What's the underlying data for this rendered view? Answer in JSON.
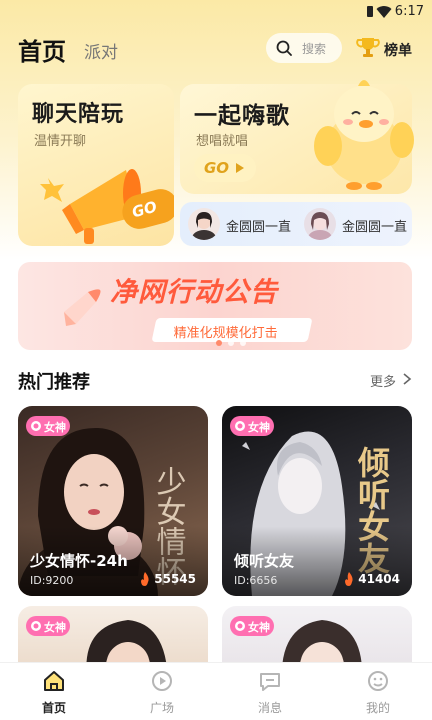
{
  "status_bar": {
    "time": "6:17"
  },
  "header": {
    "tabs": [
      {
        "label": "首页",
        "active": true
      },
      {
        "label": "派对",
        "active": false
      }
    ],
    "search_placeholder": "搜索",
    "rank_label": "榜单"
  },
  "features": {
    "chat": {
      "title": "聊天陪玩",
      "subtitle": "温情开聊",
      "go": "GO"
    },
    "sing": {
      "title": "一起嗨歌",
      "subtitle": "想唱就唱",
      "go": "GO"
    },
    "rooms": [
      {
        "name": "金圆圆一直"
      },
      {
        "name": "金圆圆一直"
      }
    ]
  },
  "banner": {
    "title": "净网行动公告",
    "subtitle": "精准化规模化打击",
    "page_count": 3,
    "active_page": 0
  },
  "section": {
    "title": "热门推荐",
    "more": "更多"
  },
  "room_cards": [
    {
      "tag": "女神",
      "name": "少女情怀-24h",
      "id": "ID:9200",
      "heat": "55545",
      "overlay_text": "少女情怀"
    },
    {
      "tag": "女神",
      "name": "倾听女友",
      "id": "ID:6656",
      "heat": "41404",
      "overlay_text": "倾听女友"
    },
    {
      "tag": "女神",
      "name": "",
      "id": "",
      "heat": ""
    },
    {
      "tag": "女神",
      "name": "",
      "id": "",
      "heat": ""
    }
  ],
  "bottom_nav": [
    {
      "label": "首页",
      "icon": "home-icon",
      "active": true
    },
    {
      "label": "广场",
      "icon": "plaza-icon",
      "active": false
    },
    {
      "label": "消息",
      "icon": "message-icon",
      "active": false
    },
    {
      "label": "我的",
      "icon": "profile-icon",
      "active": false
    }
  ],
  "colors": {
    "accent": "#f6a21e",
    "tag_pink": "#ff6fb1",
    "banner_red": "#ff5a3c",
    "header_bg": "#fbe9a6"
  }
}
